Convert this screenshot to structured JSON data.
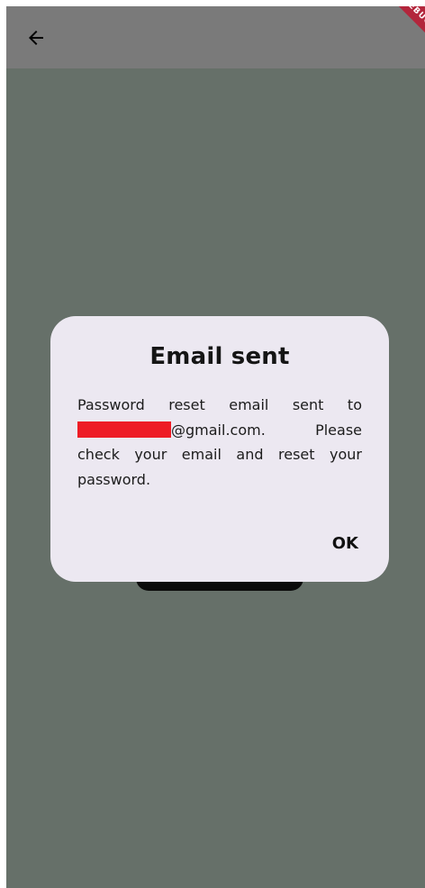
{
  "app_bar": {
    "back_icon": "arrow-back-icon",
    "debug_label": "DEBUG"
  },
  "dialog": {
    "title": "Email sent",
    "body_prefix": "Password reset email sent to",
    "email_suffix": "@gmail.com.",
    "body_suffix": "Please check your email and reset your password.",
    "ok_label": "OK"
  },
  "colors": {
    "scrim": "#667069",
    "app_bar": "#7a7a7a",
    "dialog_bg": "#ece8f1",
    "redaction": "#ee1c25",
    "debug_banner": "#b3263c"
  }
}
